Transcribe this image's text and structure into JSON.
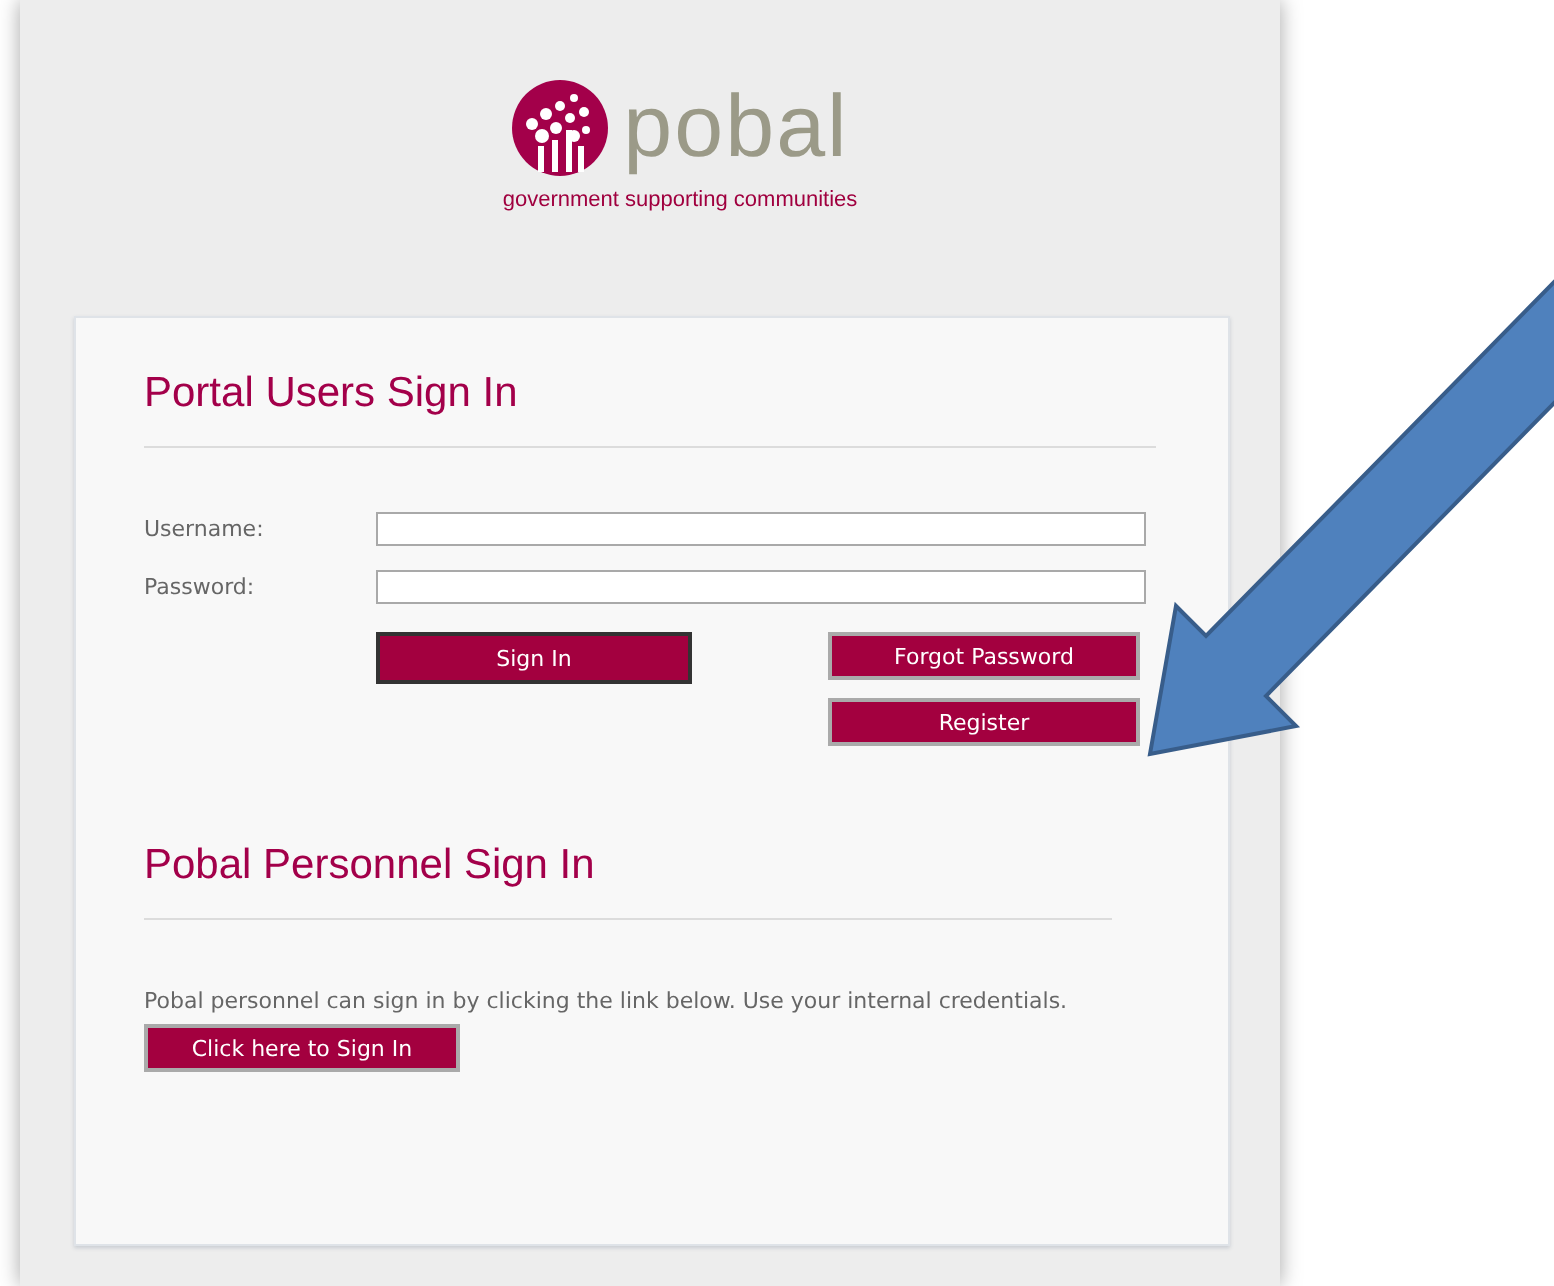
{
  "logo": {
    "wordmark": "pobal",
    "tagline": "government supporting communities"
  },
  "portal_sign_in": {
    "title": "Portal Users Sign In",
    "fields": [
      {
        "label": "Username:"
      },
      {
        "label": "Password:"
      }
    ],
    "buttons": [
      {
        "label": "Sign In",
        "focused": true
      },
      {
        "label": "Forgot Password",
        "focused": false
      },
      {
        "label": "Register",
        "focused": false
      }
    ]
  },
  "personnel_sign_in": {
    "title": "Pobal Personnel Sign In",
    "text": "Pobal personnel can sign in by clicking the link below. Use your internal credentials.",
    "button": "Click here to Sign In"
  }
}
